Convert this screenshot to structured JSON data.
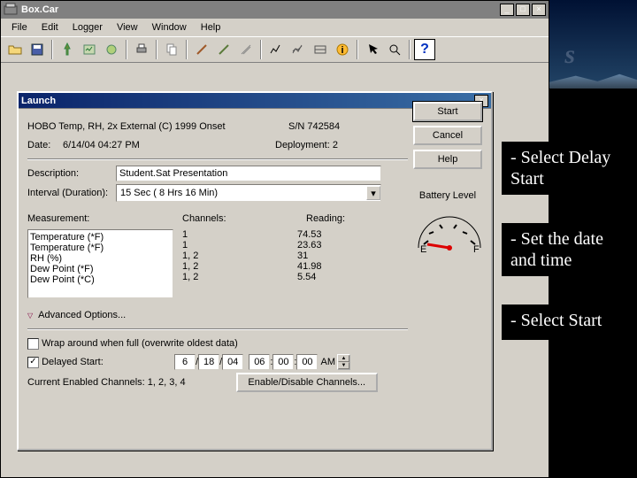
{
  "app": {
    "title": "Box.Car",
    "menu": [
      "File",
      "Edit",
      "Logger",
      "View",
      "Window",
      "Help"
    ]
  },
  "dialog": {
    "title": "Launch",
    "device_line": "HOBO Temp, RH, 2x External (C) 1999 Onset",
    "serial_label": "S/N",
    "serial_value": "742584",
    "date_label": "Date:",
    "date_value": "6/14/04 04:27 PM",
    "deployment_label": "Deployment:",
    "deployment_value": "2",
    "description_label": "Description:",
    "description_value": "Student.Sat Presentation",
    "interval_label": "Interval (Duration):",
    "interval_value": "15 Sec ( 8 Hrs 16 Min)",
    "measurement_label": "Measurement:",
    "channels_label": "Channels:",
    "reading_label": "Reading:",
    "measurements": [
      {
        "name": "Temperature (*F)",
        "channels": "1",
        "reading": "74.53"
      },
      {
        "name": "Temperature (*F)",
        "channels": "1",
        "reading": "23.63"
      },
      {
        "name": "RH (%)",
        "channels": "1, 2",
        "reading": "31"
      },
      {
        "name": "Dew Point (*F)",
        "channels": "1, 2",
        "reading": "41.98"
      },
      {
        "name": "Dew Point (*C)",
        "channels": "1, 2",
        "reading": "5.54"
      }
    ],
    "advanced_label": "Advanced Options...",
    "wrap_label": "Wrap around when full (overwrite oldest data)",
    "wrap_checked": false,
    "delayed_label": "Delayed Start:",
    "delayed_checked": true,
    "delayed_date": {
      "m": "6",
      "d": "18",
      "y": "04"
    },
    "delayed_time": {
      "h": "06",
      "min": "00",
      "s": "00",
      "ampm": "AM"
    },
    "enabled_label": "Current Enabled Channels:",
    "enabled_value": "1, 2, 3, 4",
    "enable_btn": "Enable/Disable Channels...",
    "buttons": {
      "start": "Start",
      "cancel": "Cancel",
      "help": "Help"
    },
    "battery_label": "Battery Level",
    "gauge": {
      "E": "E",
      "F": "F"
    }
  },
  "overlay": {
    "a": "- Select Delay Start",
    "b": "- Set the date and time",
    "c": "- Select Start"
  },
  "sky_letter": "s"
}
